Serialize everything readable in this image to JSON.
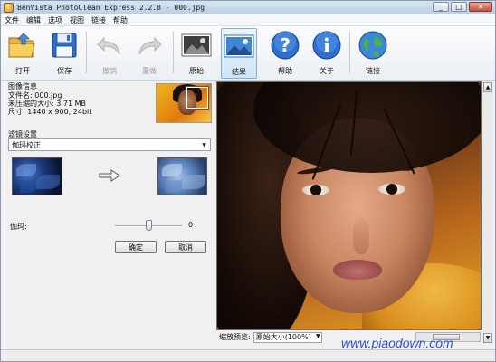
{
  "window": {
    "title": "BenVista PhotoClean Express 2.2.8 - 000.jpg"
  },
  "menu": [
    "文件",
    "编辑",
    "选项",
    "视图",
    "链接",
    "帮助"
  ],
  "toolbar": {
    "open": "打开",
    "save": "保存",
    "undo": "撤销",
    "redo": "重做",
    "original": "原始",
    "result": "结果",
    "help": "帮助",
    "about": "关于",
    "link": "链接"
  },
  "image_info": {
    "title": "图像信息",
    "filename": "文件名: 000.jpg",
    "uncompressed": "未压缩的大小: 3.71 MB",
    "dimensions": "尺寸: 1440 x 900, 24bit"
  },
  "filter": {
    "title": "滤镜设置",
    "selected": "伽玛校正"
  },
  "gamma": {
    "label": "伽玛:",
    "value": "0",
    "level": 0.5
  },
  "buttons": {
    "ok": "确定",
    "cancel": "取消"
  },
  "zoom": {
    "label": "缩放预览:",
    "selected": "原始大小(100%)"
  },
  "watermark": "www.piaodown.com",
  "colors": {
    "accent": "#2a4fd6",
    "active_tool": "#cfe6f7"
  }
}
